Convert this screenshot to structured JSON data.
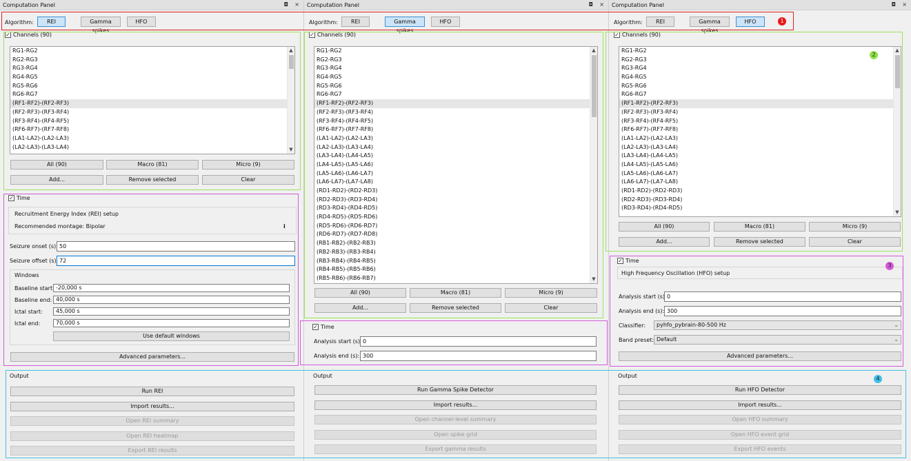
{
  "panels": [
    {
      "title": "Computation Panel",
      "algorithm_label": "Algorithm:",
      "algorithms": [
        "REI",
        "Gamma spikes",
        "HFO"
      ],
      "selected_algorithm": "REI",
      "channels_label": "Channels (90)",
      "channels": [
        "RG1-RG2",
        "RG2-RG3",
        "RG3-RG4",
        "RG4-RG5",
        "RG5-RG6",
        "RG6-RG7",
        "(RF1-RF2)-(RF2-RF3)",
        "(RF2-RF3)-(RF3-RF4)",
        "(RF3-RF4)-(RF4-RF5)",
        "(RF6-RF7)-(RF7-RF8)",
        "(LA1-LA2)-(LA2-LA3)",
        "(LA2-LA3)-(LA3-LA4)"
      ],
      "channel_buttons": [
        "All (90)",
        "Macro (81)",
        "Micro (9)"
      ],
      "action_buttons": [
        "Add...",
        "Remove selected",
        "Clear"
      ],
      "time_label": "Time",
      "setup_title": "Recruitment Energy Index (REI) setup",
      "montage": "Recommended montage: Bipolar",
      "info_glyph": "i",
      "fields": [
        {
          "label": "Seizure onset (s):",
          "value": "50"
        },
        {
          "label": "Seizure offset (s):",
          "value": "72"
        }
      ],
      "windows_label": "Windows",
      "windows": [
        {
          "label": "Baseline start:",
          "value": "-20,000 s"
        },
        {
          "label": "Baseline end:",
          "value": "40,000 s"
        },
        {
          "label": "Ictal start:",
          "value": "45,000 s"
        },
        {
          "label": "Ictal end:",
          "value": "70,000 s"
        }
      ],
      "default_windows_button": "Use default windows",
      "advanced_button": "Advanced parameters...",
      "output_label": "Output",
      "output_buttons": [
        {
          "label": "Run REI",
          "enabled": true
        },
        {
          "label": "Import results...",
          "enabled": true
        },
        {
          "label": "Open REI summary",
          "enabled": false
        },
        {
          "label": "Open REI heatmap",
          "enabled": false
        },
        {
          "label": "Export REI results",
          "enabled": false
        }
      ]
    },
    {
      "title": "Computation Panel",
      "algorithm_label": "Algorithm:",
      "algorithms": [
        "REI",
        "Gamma spikes",
        "HFO"
      ],
      "selected_algorithm": "Gamma spikes",
      "channels_label": "Channels (90)",
      "channels": [
        "RG1-RG2",
        "RG2-RG3",
        "RG3-RG4",
        "RG4-RG5",
        "RG5-RG6",
        "RG6-RG7",
        "(RF1-RF2)-(RF2-RF3)",
        "(RF2-RF3)-(RF3-RF4)",
        "(RF3-RF4)-(RF4-RF5)",
        "(RF6-RF7)-(RF7-RF8)",
        "(LA1-LA2)-(LA2-LA3)",
        "(LA2-LA3)-(LA3-LA4)",
        "(LA3-LA4)-(LA4-LA5)",
        "(LA4-LA5)-(LA5-LA6)",
        "(LA5-LA6)-(LA6-LA7)",
        "(LA6-LA7)-(LA7-LA8)",
        "(RD1-RD2)-(RD2-RD3)",
        "(RD2-RD3)-(RD3-RD4)",
        "(RD3-RD4)-(RD4-RD5)",
        "(RD4-RD5)-(RD5-RD6)",
        "(RD5-RD6)-(RD6-RD7)",
        "(RD6-RD7)-(RD7-RD8)",
        "(RB1-RB2)-(RB2-RB3)",
        "(RB2-RB3)-(RB3-RB4)",
        "(RB3-RB4)-(RB4-RB5)",
        "(RB4-RB5)-(RB5-RB6)",
        "(RB5-RB6)-(RB6-RB7)"
      ],
      "channel_buttons": [
        "All (90)",
        "Macro (81)",
        "Micro (9)"
      ],
      "action_buttons": [
        "Add...",
        "Remove selected",
        "Clear"
      ],
      "time_label": "Time",
      "fields": [
        {
          "label": "Analysis start (s):",
          "value": "0"
        },
        {
          "label": "Analysis end (s):",
          "value": "300"
        }
      ],
      "output_label": "Output",
      "output_buttons": [
        {
          "label": "Run Gamma Spike Detector",
          "enabled": true
        },
        {
          "label": "Import results...",
          "enabled": true
        },
        {
          "label": "Open channel-level summary",
          "enabled": false
        },
        {
          "label": "Open spike grid",
          "enabled": false
        },
        {
          "label": "Export gamma results",
          "enabled": false
        }
      ]
    },
    {
      "title": "Computation Panel",
      "algorithm_label": "Algorithm:",
      "algorithms": [
        "REI",
        "Gamma spikes",
        "HFO"
      ],
      "selected_algorithm": "HFO",
      "channels_label": "Channels (90)",
      "channels": [
        "RG1-RG2",
        "RG2-RG3",
        "RG3-RG4",
        "RG4-RG5",
        "RG5-RG6",
        "RG6-RG7",
        "(RF1-RF2)-(RF2-RF3)",
        "(RF2-RF3)-(RF3-RF4)",
        "(RF3-RF4)-(RF4-RF5)",
        "(RF6-RF7)-(RF7-RF8)",
        "(LA1-LA2)-(LA2-LA3)",
        "(LA2-LA3)-(LA3-LA4)",
        "(LA3-LA4)-(LA4-LA5)",
        "(LA4-LA5)-(LA5-LA6)",
        "(LA5-LA6)-(LA6-LA7)",
        "(LA6-LA7)-(LA7-LA8)",
        "(RD1-RD2)-(RD2-RD3)",
        "(RD2-RD3)-(RD3-RD4)",
        "(RD3-RD4)-(RD4-RD5)"
      ],
      "channel_buttons": [
        "All (90)",
        "Macro (81)",
        "Micro (9)"
      ],
      "action_buttons": [
        "Add...",
        "Remove selected",
        "Clear"
      ],
      "time_label": "Time",
      "setup_title": "High Frequency Oscillation (HFO) setup",
      "fields": [
        {
          "label": "Analysis start (s):",
          "value": "0"
        },
        {
          "label": "Analysis end (s):",
          "value": "300"
        }
      ],
      "combos": [
        {
          "label": "Classifier:",
          "value": "pyhfo_pybrain-80-500 Hz"
        },
        {
          "label": "Band preset:",
          "value": "Default"
        }
      ],
      "advanced_button": "Advanced parameters...",
      "output_label": "Output",
      "output_buttons": [
        {
          "label": "Run HFO Detector",
          "enabled": true
        },
        {
          "label": "Import results...",
          "enabled": true
        },
        {
          "label": "Open HFO summary",
          "enabled": false
        },
        {
          "label": "Open HFO event grid",
          "enabled": false
        },
        {
          "label": "Export HFO events",
          "enabled": false
        }
      ]
    }
  ],
  "window_controls": {
    "float": "◘",
    "close": "×"
  },
  "checkmark": "✓",
  "combo_chevron": "⌄",
  "scroll_arrows": {
    "up": "▲",
    "down": "▼"
  },
  "spin_arrows": "▲▼",
  "annotations": [
    {
      "label": "1",
      "color": "#e81818"
    },
    {
      "label": "2",
      "color": "#8ee04a"
    },
    {
      "label": "3",
      "color": "#d35ad8"
    },
    {
      "label": "4",
      "color": "#3fbfe8"
    }
  ]
}
